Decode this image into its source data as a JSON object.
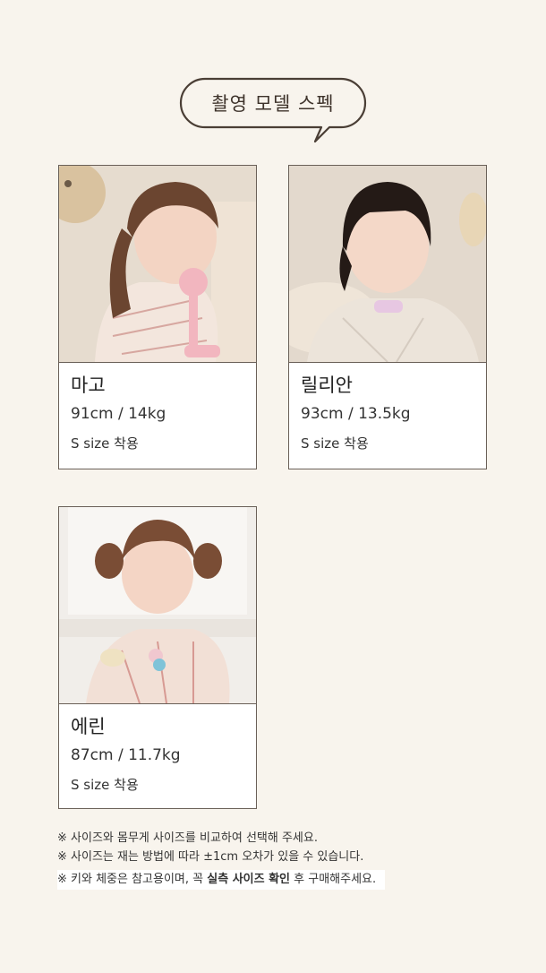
{
  "title": "촬영 모델 스펙",
  "models": [
    {
      "name": "마고",
      "stats": "91cm / 14kg",
      "size": "S size 착용"
    },
    {
      "name": "릴리안",
      "stats": "93cm / 13.5kg",
      "size": "S size 착용"
    },
    {
      "name": "에린",
      "stats": "87cm / 11.7kg",
      "size": "S size 착용"
    }
  ],
  "notes": [
    "※ 사이즈와 몸무게 사이즈를 비교하여 선택해 주세요.",
    "※ 사이즈는 재는 방법에 따라 ±1cm 오차가 있을 수 있습니다."
  ],
  "highlight_note": {
    "prefix": "※ 키와 체중은 참고용이며, 꼭 ",
    "bold": "실측 사이즈 확인",
    "suffix": " 후 구매해주세요."
  },
  "colors": {
    "background": "#f8f4ed",
    "border": "#6a6058",
    "bubble": "#4a3e35"
  }
}
